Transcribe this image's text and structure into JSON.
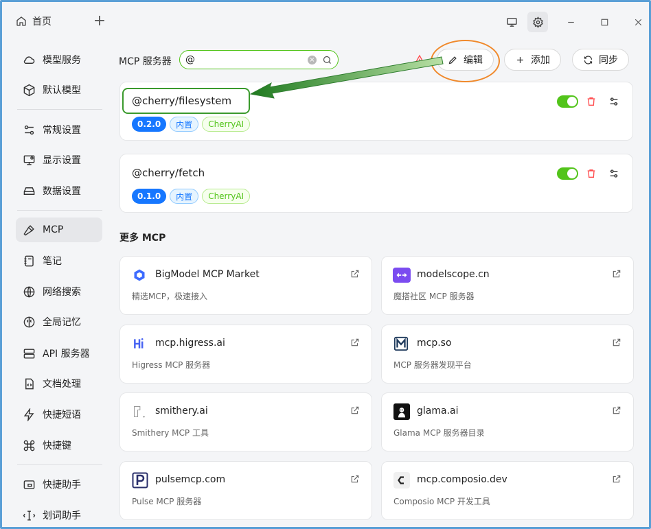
{
  "titlebar": {
    "home_tab": "首页",
    "add_tab": "+"
  },
  "sidebar": {
    "items": [
      {
        "label": "模型服务",
        "icon": "cloud-icon"
      },
      {
        "label": "默认模型",
        "icon": "cube-icon"
      },
      {
        "label": "常规设置",
        "icon": "settings-sliders-icon"
      },
      {
        "label": "显示设置",
        "icon": "monitor-icon"
      },
      {
        "label": "数据设置",
        "icon": "hard-drive-icon"
      },
      {
        "label": "MCP",
        "icon": "hammer-icon"
      },
      {
        "label": "笔记",
        "icon": "notebook-icon"
      },
      {
        "label": "网络搜索",
        "icon": "globe-icon"
      },
      {
        "label": "全局记忆",
        "icon": "brain-icon"
      },
      {
        "label": "API 服务器",
        "icon": "server-icon"
      },
      {
        "label": "文档处理",
        "icon": "file-code-icon"
      },
      {
        "label": "快捷短语",
        "icon": "zap-icon"
      },
      {
        "label": "快捷键",
        "icon": "command-icon"
      },
      {
        "label": "快捷助手",
        "icon": "app-window-icon"
      },
      {
        "label": "划词助手",
        "icon": "text-cursor-icon"
      }
    ],
    "active": "MCP"
  },
  "toolbar": {
    "title": "MCP 服务器",
    "search_value": "@",
    "edit_label": "编辑",
    "add_label": "添加",
    "sync_label": "同步"
  },
  "servers": [
    {
      "name": "@cherry/filesystem",
      "version": "0.2.0",
      "tag_builtin": "内置",
      "tag_vendor": "CherryAI",
      "enabled": true
    },
    {
      "name": "@cherry/fetch",
      "version": "0.1.0",
      "tag_builtin": "内置",
      "tag_vendor": "CherryAI",
      "enabled": true
    }
  ],
  "more": {
    "title": "更多 MCP",
    "markets": [
      {
        "name": "BigModel MCP Market",
        "desc": "精选MCP，极速接入",
        "logo": "bigmodel-logo"
      },
      {
        "name": "modelscope.cn",
        "desc": "魔搭社区 MCP 服务器",
        "logo": "modelscope-logo"
      },
      {
        "name": "mcp.higress.ai",
        "desc": "Higress MCP 服务器",
        "logo": "higress-logo"
      },
      {
        "name": "mcp.so",
        "desc": "MCP 服务器发现平台",
        "logo": "mcpso-logo"
      },
      {
        "name": "smithery.ai",
        "desc": "Smithery MCP 工具",
        "logo": "smithery-logo"
      },
      {
        "name": "glama.ai",
        "desc": "Glama MCP 服务器目录",
        "logo": "glama-logo"
      },
      {
        "name": "pulsemcp.com",
        "desc": "Pulse MCP 服务器",
        "logo": "pulsemcp-logo"
      },
      {
        "name": "mcp.composio.dev",
        "desc": "Composio MCP 开发工具",
        "logo": "composio-logo"
      }
    ]
  },
  "colors": {
    "accent_green": "#52c41a",
    "accent_blue": "#1677ff",
    "annotation_orange": "#f0892b",
    "annotation_green": "#3a9a2c",
    "danger": "#ff4d4f"
  }
}
